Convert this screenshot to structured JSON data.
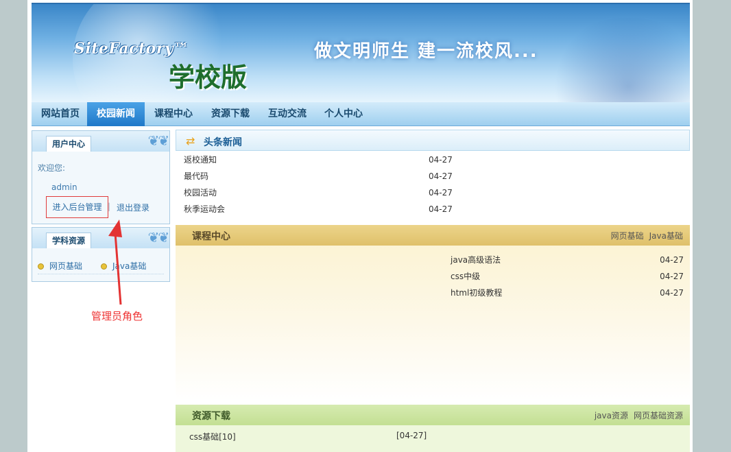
{
  "banner": {
    "brand": "SiteFactory™",
    "edition": "学校版",
    "slogan": "做文明师生  建一流校风..."
  },
  "nav": {
    "items": [
      {
        "label": "网站首页"
      },
      {
        "label": "校园新闻"
      },
      {
        "label": "课程中心"
      },
      {
        "label": "资源下载"
      },
      {
        "label": "互动交流"
      },
      {
        "label": "个人中心"
      }
    ]
  },
  "user_center": {
    "title": "用户中心",
    "welcome": "欢迎您:",
    "username": "admin",
    "admin_link": "进入后台管理",
    "separator": "|",
    "logout": "退出登录"
  },
  "subjects": {
    "title": "学科资源",
    "items": [
      {
        "label": "网页基础"
      },
      {
        "label": "Java基础"
      }
    ]
  },
  "annotation": {
    "text": "管理员角色",
    "color": "#e33333"
  },
  "headline_news": {
    "title": "头条新闻",
    "rows": [
      {
        "title": "返校通知",
        "date": "04-27"
      },
      {
        "title": "最代码",
        "date": "04-27"
      },
      {
        "title": "校园活动",
        "date": "04-27"
      },
      {
        "title": "秋季运动会",
        "date": "04-27"
      }
    ]
  },
  "course_center": {
    "title": "课程中心",
    "links": [
      "网页基础",
      "Java基础"
    ],
    "rows": [
      {
        "title": "java高级语法",
        "date": "04-27"
      },
      {
        "title": "css中级",
        "date": "04-27"
      },
      {
        "title": "html初级教程",
        "date": "04-27"
      }
    ]
  },
  "downloads": {
    "title": "资源下载",
    "links": [
      "java资源",
      "网页基础资源"
    ],
    "rows": [
      {
        "title": "css基础[10]",
        "date": "[04-27]"
      }
    ]
  }
}
